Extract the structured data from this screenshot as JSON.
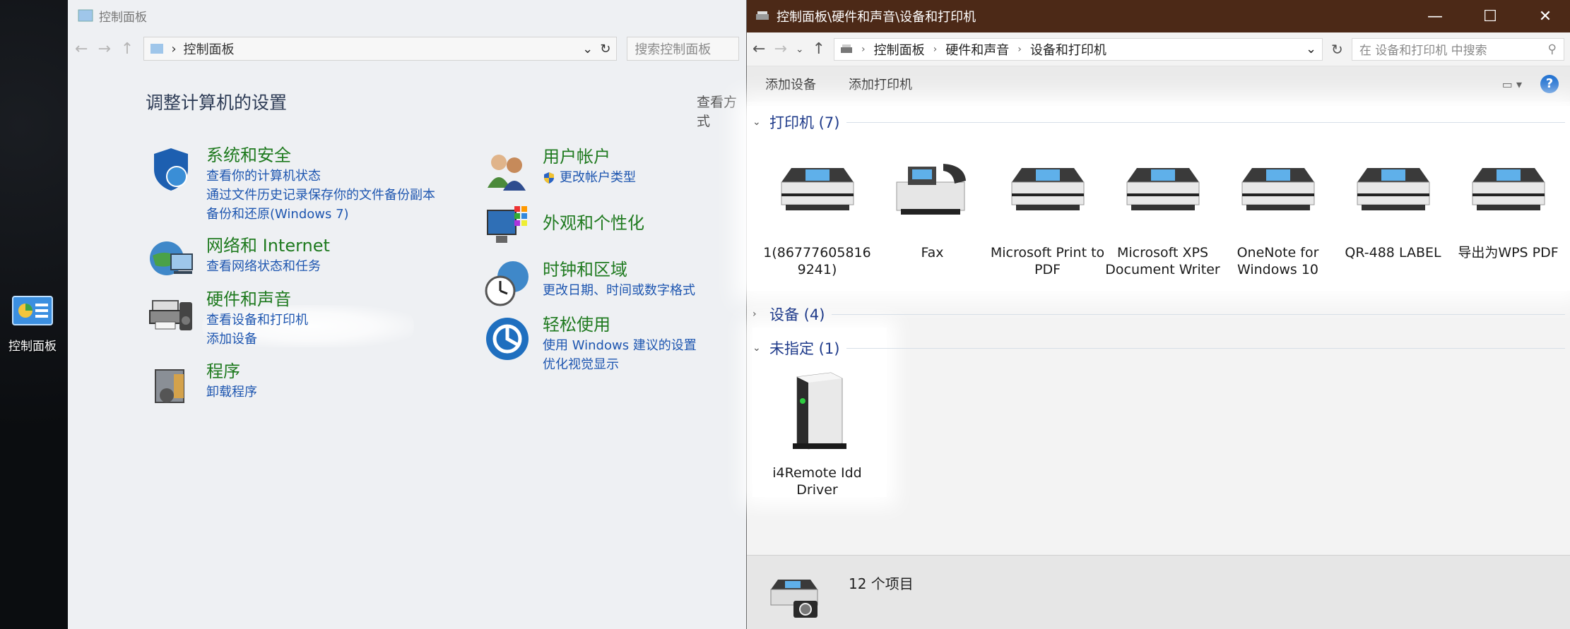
{
  "desktop": {
    "icon_label": "控制面板"
  },
  "background_window": {
    "title": "控制面板",
    "address": "控制面板",
    "search_placeholder": "搜索控制面板",
    "heading": "调整计算机的设置",
    "view_by": "查看方式",
    "categories": [
      {
        "name": "系统和安全",
        "links": [
          "查看你的计算机状态",
          "通过文件历史记录保存你的文件备份副本",
          "备份和还原(Windows 7)"
        ],
        "icon": "shield-icon"
      },
      {
        "name": "网络和 Internet",
        "links": [
          "查看网络状态和任务"
        ],
        "icon": "network-globe-icon"
      },
      {
        "name": "硬件和声音",
        "links": [
          "查看设备和打印机",
          "添加设备"
        ],
        "icon": "printer-speaker-icon"
      },
      {
        "name": "程序",
        "links": [
          "卸载程序"
        ],
        "icon": "programs-box-icon"
      },
      {
        "name": "用户帐户",
        "links": [
          "更改帐户类型"
        ],
        "icon": "users-icon"
      },
      {
        "name": "外观和个性化",
        "links": [],
        "icon": "display-palette-icon"
      },
      {
        "name": "时钟和区域",
        "links": [
          "更改日期、时间或数字格式"
        ],
        "icon": "clock-globe-icon"
      },
      {
        "name": "轻松使用",
        "links": [
          "使用 Windows 建议的设置",
          "优化视觉显示"
        ],
        "icon": "ease-of-access-icon"
      }
    ]
  },
  "window": {
    "title": "控制面板\\硬件和声音\\设备和打印机",
    "breadcrumb": [
      "控制面板",
      "硬件和声音",
      "设备和打印机"
    ],
    "search_placeholder": "在 设备和打印机 中搜索",
    "commands": {
      "add_device": "添加设备",
      "add_printer": "添加打印机",
      "help": "?"
    },
    "groups": {
      "printers": {
        "label": "打印机 (7)",
        "expanded": true
      },
      "devices": {
        "label": "设备 (4)",
        "expanded": false
      },
      "unspecified": {
        "label": "未指定 (1)",
        "expanded": true
      }
    },
    "printers": [
      {
        "name": "1(86777605816 9241)",
        "icon": "printer-icon"
      },
      {
        "name": "Fax",
        "icon": "fax-icon"
      },
      {
        "name": "Microsoft Print to PDF",
        "icon": "printer-icon"
      },
      {
        "name": "Microsoft XPS Document Writer",
        "icon": "printer-icon"
      },
      {
        "name": "OneNote for Windows 10",
        "icon": "printer-icon"
      },
      {
        "name": "QR-488 LABEL",
        "icon": "printer-icon"
      },
      {
        "name": "导出为WPS PDF",
        "icon": "printer-icon"
      }
    ],
    "unspecified": [
      {
        "name": "i4Remote Idd Driver",
        "icon": "server-tower-icon"
      }
    ],
    "status": "12 个项目"
  },
  "colors": {
    "titlebar": "#4c2917",
    "group_title": "#1e3a8a",
    "category_green": "#1f7a1f",
    "link_blue": "#1e56b0"
  }
}
